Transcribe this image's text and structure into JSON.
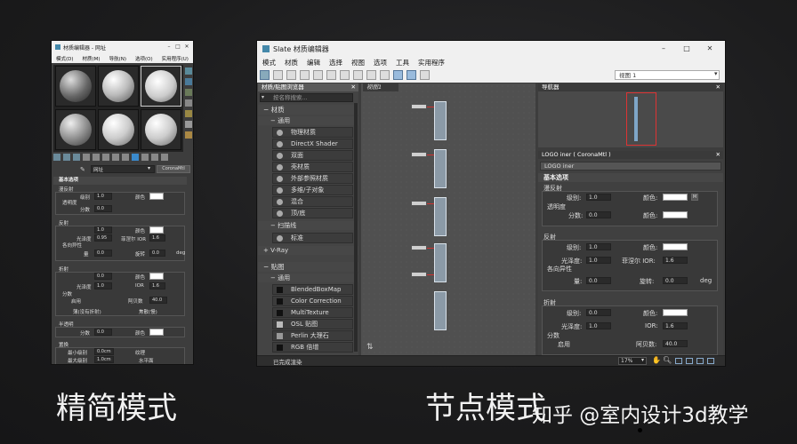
{
  "captions": {
    "left": "精简模式",
    "right": "节点模式",
    "watermark": "知乎 @室内设计3d教学"
  },
  "compact": {
    "title": "材质编辑器 - 网址",
    "menu": [
      "模式(D)",
      "材质(M)",
      "导航(N)",
      "选项(O)",
      "实用程序(U)"
    ],
    "mat_name": "网址",
    "mat_type": "CoronaMtl",
    "rollout": "基本选项",
    "diffuse": {
      "title": "漫反射",
      "level_label": "级别",
      "level": "1.0",
      "color_label": "颜色",
      "transp_label": "透明度",
      "frac_label": "分数",
      "frac": "0.0"
    },
    "reflect": {
      "title": "反射",
      "level": "1.0",
      "color_label": "颜色",
      "gloss_label": "光泽度",
      "gloss": "0.95",
      "fresnel_label": "菲涅尔 IOR",
      "fresnel": "1.6",
      "aniso_label": "各向异性",
      "amount_label": "量",
      "amount": "0.0",
      "rot_label": "旋转",
      "rot": "0.0",
      "deg": "deg"
    },
    "refract": {
      "title": "折射",
      "level": "0.0",
      "color_label": "颜色",
      "gloss_label": "光泽度",
      "gloss": "1.0",
      "ior_label": "IOR",
      "ior": "1.6",
      "disp_label": "分数",
      "enable_label": "启用",
      "abbe_label": "阿贝数",
      "abbe": "40.0",
      "thin_label": "薄(没有折射)",
      "caustics_label": "焦散(慢)"
    },
    "translucency": {
      "title": "半透明",
      "frac_label": "分数",
      "frac": "0.0",
      "color_label": "颜色"
    },
    "displace": {
      "title": "置换",
      "min_label": "最小级别",
      "min": "0.0cm",
      "mode_label": "纹理",
      "max_label": "最大级别",
      "max": "1.0cm",
      "water_label": "水平面"
    }
  },
  "slate": {
    "title": "Slate 材质编辑器",
    "menu": [
      "模式",
      "材质",
      "编辑",
      "选择",
      "视图",
      "选项",
      "工具",
      "实用程序"
    ],
    "view_dropdown": "视图 1",
    "browser_title": "材质/贴图浏览器",
    "search_placeholder": "按名称搜索...",
    "group_materials": "材质",
    "group_general": "通用",
    "materials": [
      "物理材质",
      "DirectX Shader",
      "双面",
      "壳材质",
      "外部参照材质",
      "多维/子对象",
      "混合",
      "顶/底"
    ],
    "group_scanline": "扫描线",
    "scanline_items": [
      "标准"
    ],
    "group_vray": "+ V-Ray",
    "group_maps": "贴图",
    "group_maps_general": "通用",
    "maps": [
      "BlendedBoxMap",
      "Color Correction",
      "MultiTexture",
      "OSL 贴图",
      "Perlin 大理石",
      "RGB 倍增"
    ],
    "view_tab": "视图1",
    "navigator_title": "导航器",
    "props_title": "LOGO iner ( CoronaMtl )",
    "props_name": "LOGO iner",
    "props_rollout": "基本选项",
    "diffuse": {
      "title": "漫反射",
      "level_label": "级别:",
      "level": "1.0",
      "color_label": "颜色:",
      "transp_label": "透明度",
      "frac_label": "分数:",
      "frac": "0.0"
    },
    "reflect": {
      "title": "反射",
      "level_label": "级别:",
      "level": "1.0",
      "color_label": "颜色:",
      "gloss_label": "光泽度:",
      "gloss": "1.0",
      "fresnel_label": "菲涅尔 IOR:",
      "fresnel": "1.6",
      "aniso_label": "各向异性",
      "amount_label": "量:",
      "amount": "0.0",
      "rot_label": "旋转:",
      "rot": "0.0",
      "deg": "deg"
    },
    "refract": {
      "title": "折射",
      "level_label": "级别:",
      "level": "0.0",
      "color_label": "颜色:",
      "gloss_label": "光泽度:",
      "gloss": "1.0",
      "ior_label": "IOR:",
      "ior": "1.6",
      "disp_label": "分数",
      "enable_label": "启用",
      "abbe_label": "阿贝数:",
      "abbe": "40.0"
    },
    "status": "已完成渲染",
    "zoom": "17%"
  }
}
